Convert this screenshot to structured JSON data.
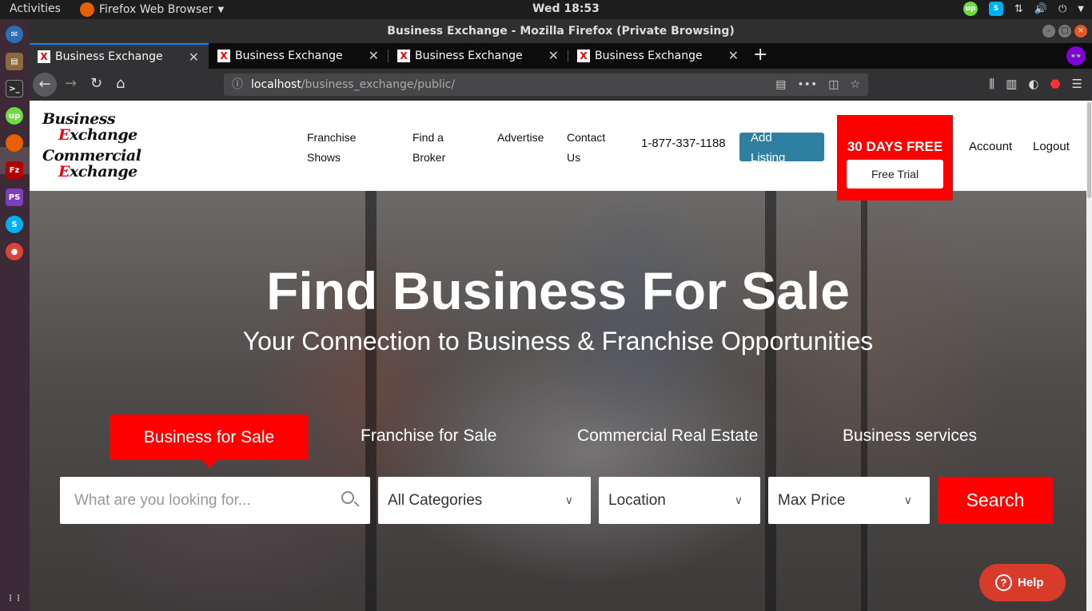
{
  "system": {
    "activities": "Activities",
    "app_name": "Firefox Web Browser",
    "clock": "Wed 18:53"
  },
  "window": {
    "title": "Business Exchange - Mozilla Firefox (Private Browsing)"
  },
  "tabs": [
    {
      "label": "Business Exchange"
    },
    {
      "label": "Business Exchange"
    },
    {
      "label": "Business Exchange"
    },
    {
      "label": "Business Exchange"
    }
  ],
  "url": {
    "host": "localhost",
    "path": "/business_exchange/public/"
  },
  "site": {
    "logo": {
      "line1": "Business",
      "line2a": "E",
      "line2b": "xchange",
      "line3": "Commercial",
      "line4a": "E",
      "line4b": "xchange"
    },
    "nav": {
      "franchise_shows_1": "Franchise",
      "franchise_shows_2": "Shows",
      "find_broker_1": "Find a",
      "find_broker_2": "Broker",
      "advertise": "Advertise",
      "contact_1": "Contact",
      "contact_2": "Us",
      "phone": "1-877-337-1188",
      "add_listing_1": "Add",
      "add_listing_2": "Listing",
      "promo_days": "30 DAYS FREE",
      "promo_trial": "Free Trial",
      "account": "Account",
      "logout": "Logout"
    },
    "hero": {
      "title": "Find Business For Sale",
      "subtitle": "Your Connection to Business & Franchise Opportunities"
    },
    "search_tabs": [
      {
        "label": "Business for Sale"
      },
      {
        "label": "Franchise for Sale"
      },
      {
        "label": "Commercial Real Estate"
      },
      {
        "label": "Business services"
      }
    ],
    "search": {
      "placeholder": "What are you looking for...",
      "category": "All Categories",
      "location": "Location",
      "max_price": "Max Price",
      "button": "Search"
    },
    "help": "Help"
  },
  "colors": {
    "brand_red": "#ff0000",
    "add_listing_blue": "#2f7fa0",
    "help_red": "#d93b2b"
  }
}
